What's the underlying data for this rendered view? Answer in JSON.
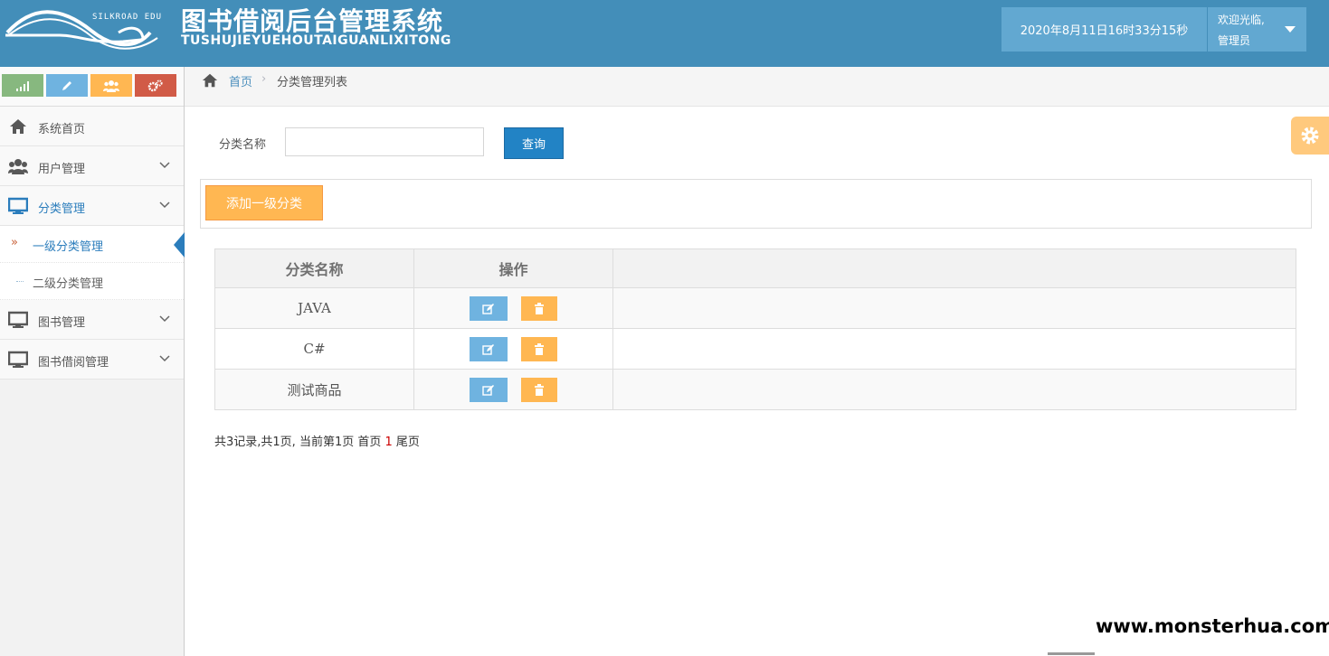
{
  "header": {
    "brand_en": "SILKROAD EDU",
    "title_cn": "图书借阅后台管理系统",
    "title_en": "TUSHUJIEYUEHOUTAIGUANLIXITONG",
    "datetime": "2020年8月11日16时33分15秒",
    "welcome": "欢迎光临,",
    "role": "管理员"
  },
  "shortcuts": [
    {
      "icon": "signal-icon",
      "color": "#87b87f"
    },
    {
      "icon": "pencil-icon",
      "color": "#6fb3e0"
    },
    {
      "icon": "users-icon",
      "color": "#ffb752"
    },
    {
      "icon": "cogs-icon",
      "color": "#d15b47"
    }
  ],
  "sidebar": {
    "items": [
      {
        "label": "系统首页",
        "icon": "home-icon"
      },
      {
        "label": "用户管理",
        "icon": "users-icon"
      },
      {
        "label": "分类管理",
        "icon": "desktop-icon"
      },
      {
        "label": "图书管理",
        "icon": "desktop-icon"
      },
      {
        "label": "图书借阅管理",
        "icon": "desktop-icon"
      }
    ],
    "sub_items": [
      {
        "label": "一级分类管理"
      },
      {
        "label": "二级分类管理"
      }
    ]
  },
  "breadcrumb": {
    "home": "首页",
    "current": "分类管理列表"
  },
  "search": {
    "label": "分类名称",
    "value": "",
    "query_label": "查询"
  },
  "toolbar": {
    "add_label": "添加一级分类"
  },
  "table": {
    "columns": [
      "分类名称",
      "操作"
    ],
    "rows": [
      {
        "name": "JAVA"
      },
      {
        "name": "C#"
      },
      {
        "name": "测试商品"
      }
    ]
  },
  "pagination": {
    "prefix": "共3记录,共1页, 当前第1页 首页 ",
    "current": "1",
    "suffix": " 尾页"
  },
  "watermark": "www.monsterhua.com",
  "colors": {
    "header_bg": "#438eb9",
    "accent": "#2b7dbc",
    "warning": "#ffb752",
    "info": "#6fb3e0"
  }
}
